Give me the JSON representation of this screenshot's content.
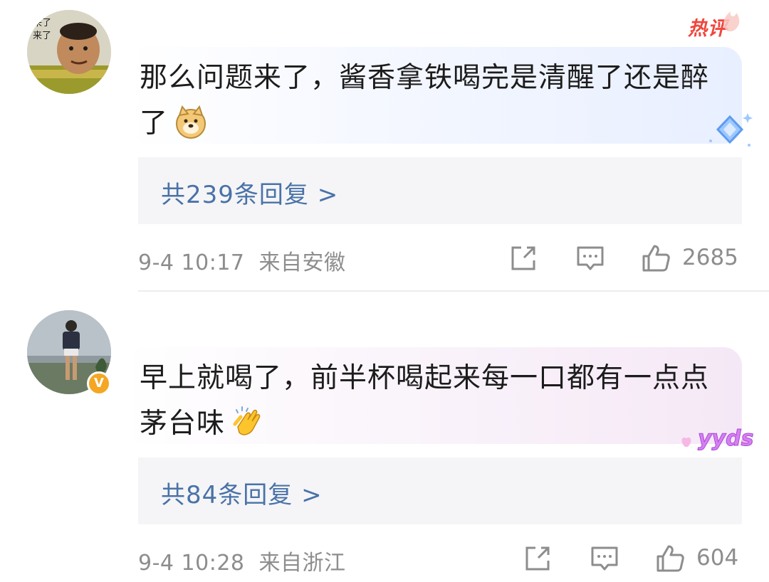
{
  "comments": [
    {
      "avatar_caption": [
        "来了",
        "来了"
      ],
      "hot_badge": "热评",
      "text": "那么问题来了，酱香拿铁喝完是清醒了还是醉了",
      "emoji": "doge-emoji",
      "replies_label": "共239条回复 >",
      "time": "9-4 10:17",
      "location": "来自安徽",
      "like_count": "2685"
    },
    {
      "verified_badge": "V",
      "text": "早上就喝了，前半杯喝起来每一口都有一点点茅台味",
      "emoji": "clapping-hands-emoji",
      "decoration_text": "yyds",
      "replies_label": "共84条回复 >",
      "time": "9-4 10:28",
      "location": "来自浙江",
      "like_count": "604"
    }
  ],
  "colors": {
    "hot": "#f0463c",
    "link": "#4a72a8",
    "meta": "#8d8d8d",
    "reply_bg": "#f5f5f7",
    "verified": "#f5a623"
  },
  "icons": [
    "share-icon",
    "comment-icon",
    "thumbs-up-icon"
  ]
}
